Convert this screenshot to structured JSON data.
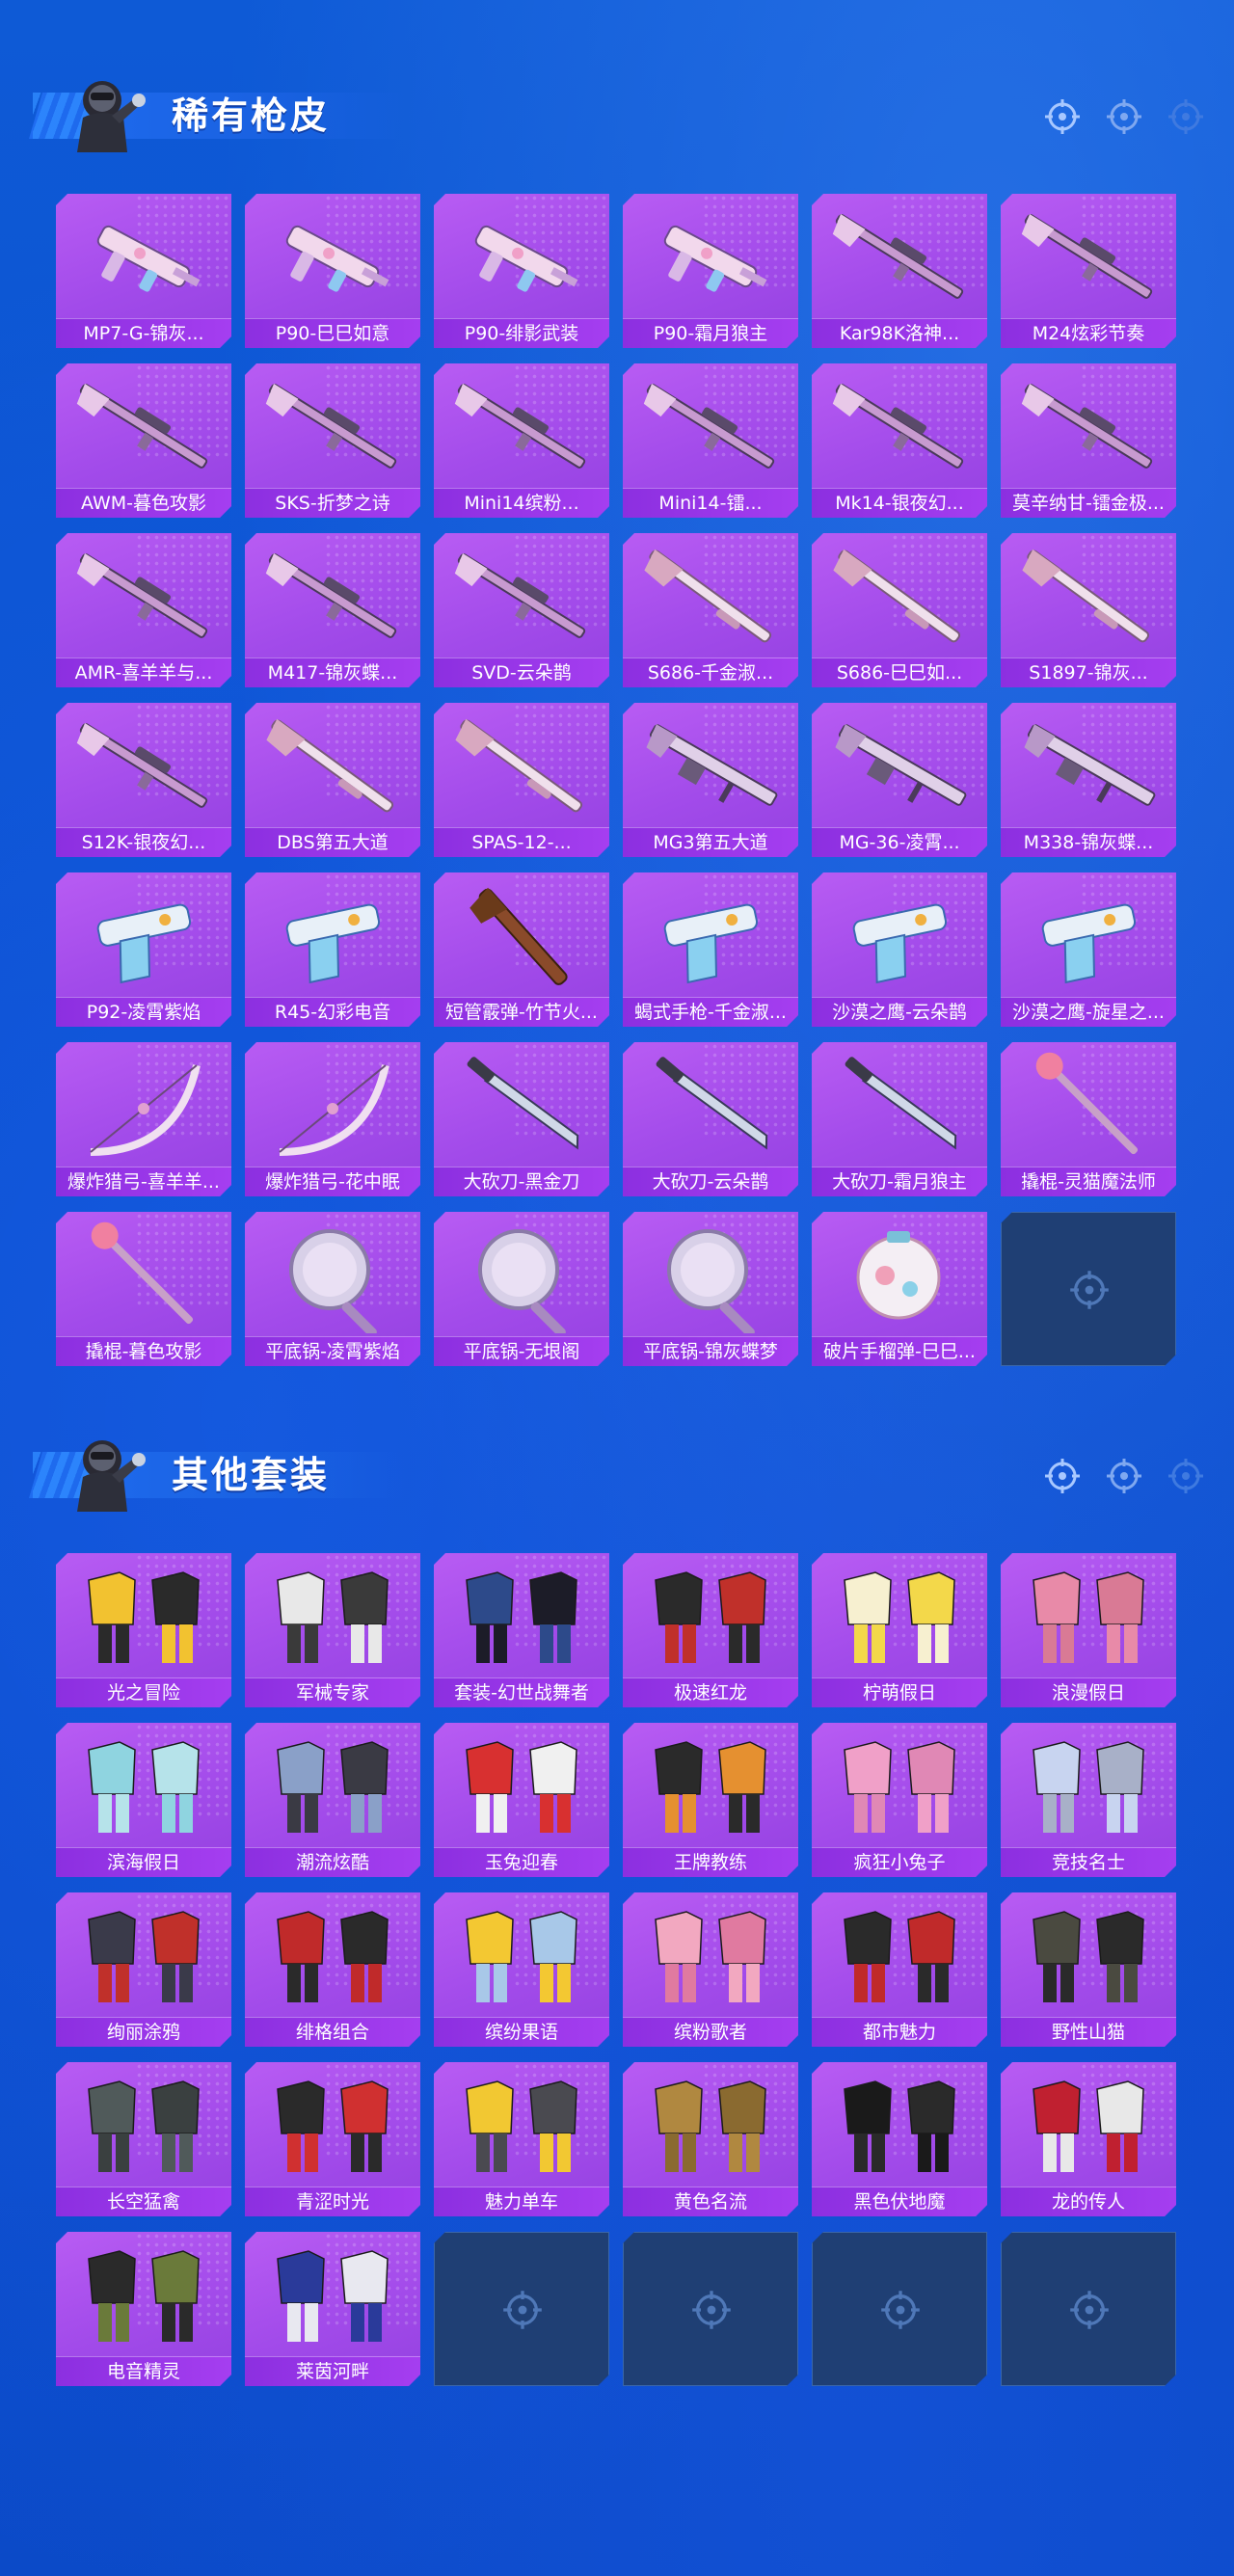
{
  "colors": {
    "background": "#0b4fd0",
    "card": "#a84ff0",
    "label_bar": "#9a38e8",
    "empty_slot": "#1f3f74",
    "accent_light": "#a8c8ff"
  },
  "sections": {
    "weapons": {
      "title": "稀有枪皮",
      "icon": "soldier-avatar-icon",
      "items": [
        {
          "label": "MP7-G-锦灰...",
          "icon": "smg-icon"
        },
        {
          "label": "P90-巳巳如意",
          "icon": "smg-icon"
        },
        {
          "label": "P90-绯影武装",
          "icon": "smg-icon"
        },
        {
          "label": "P90-霜月狼主",
          "icon": "smg-icon"
        },
        {
          "label": "Kar98K洛神...",
          "icon": "rifle-icon"
        },
        {
          "label": "M24炫彩节奏",
          "icon": "rifle-icon"
        },
        {
          "label": "AWM-暮色攻影",
          "icon": "rifle-icon"
        },
        {
          "label": "SKS-折梦之诗",
          "icon": "rifle-icon"
        },
        {
          "label": "Mini14缤粉...",
          "icon": "rifle-icon"
        },
        {
          "label": "Mini14-镭...",
          "icon": "rifle-icon"
        },
        {
          "label": "Mk14-银夜幻...",
          "icon": "rifle-icon"
        },
        {
          "label": "莫辛纳甘-镭金极...",
          "icon": "rifle-icon"
        },
        {
          "label": "AMR-喜羊羊与...",
          "icon": "rifle-icon"
        },
        {
          "label": "M417-锦灰蝶...",
          "icon": "rifle-icon"
        },
        {
          "label": "SVD-云朵鹊",
          "icon": "rifle-icon"
        },
        {
          "label": "S686-千金淑...",
          "icon": "shotgun-icon"
        },
        {
          "label": "S686-巳巳如...",
          "icon": "shotgun-icon"
        },
        {
          "label": "S1897-锦灰...",
          "icon": "shotgun-icon"
        },
        {
          "label": "S12K-银夜幻...",
          "icon": "rifle-icon"
        },
        {
          "label": "DBS第五大道",
          "icon": "shotgun-icon"
        },
        {
          "label": "SPAS-12-...",
          "icon": "shotgun-icon"
        },
        {
          "label": "MG3第五大道",
          "icon": "machinegun-icon"
        },
        {
          "label": "MG-36-凌霄...",
          "icon": "machinegun-icon"
        },
        {
          "label": "M338-锦灰蝶...",
          "icon": "machinegun-icon"
        },
        {
          "label": "P92-凌霄紫焰",
          "icon": "pistol-icon"
        },
        {
          "label": "R45-幻彩电音",
          "icon": "pistol-icon"
        },
        {
          "label": "短管霰弹-竹节火...",
          "icon": "sawed-off-icon"
        },
        {
          "label": "蝎式手枪-千金淑...",
          "icon": "pistol-icon"
        },
        {
          "label": "沙漠之鹰-云朵鹊",
          "icon": "pistol-icon"
        },
        {
          "label": "沙漠之鹰-旋星之...",
          "icon": "pistol-icon"
        },
        {
          "label": "爆炸猎弓-喜羊羊...",
          "icon": "bow-icon"
        },
        {
          "label": "爆炸猎弓-花中眠",
          "icon": "bow-icon"
        },
        {
          "label": "大砍刀-黑金刀",
          "icon": "machete-icon"
        },
        {
          "label": "大砍刀-云朵鹊",
          "icon": "machete-icon"
        },
        {
          "label": "大砍刀-霜月狼主",
          "icon": "machete-icon"
        },
        {
          "label": "撬棍-灵猫魔法师",
          "icon": "crowbar-icon"
        },
        {
          "label": "撬棍-暮色攻影",
          "icon": "crowbar-icon"
        },
        {
          "label": "平底锅-凌霄紫焰",
          "icon": "pan-icon"
        },
        {
          "label": "平底锅-无垠阁",
          "icon": "pan-icon"
        },
        {
          "label": "平底锅-锦灰蝶梦",
          "icon": "pan-icon"
        },
        {
          "label": "破片手榴弹-巳巳...",
          "icon": "grenade-icon"
        }
      ],
      "empty_slots": 1
    },
    "outfits": {
      "title": "其他套装",
      "icon": "soldier-avatar-icon",
      "items": [
        {
          "label": "光之冒险",
          "icon": "outfit-icon",
          "c1": "#f2c230",
          "c2": "#2a2a2a"
        },
        {
          "label": "军械专家",
          "icon": "outfit-icon",
          "c1": "#e8e8e8",
          "c2": "#3a3a3a"
        },
        {
          "label": "套装-幻世战舞者",
          "icon": "outfit-icon",
          "c1": "#2d4a8a",
          "c2": "#1c1c28"
        },
        {
          "label": "极速红龙",
          "icon": "outfit-icon",
          "c1": "#2a2a2a",
          "c2": "#c0302a"
        },
        {
          "label": "柠萌假日",
          "icon": "outfit-icon",
          "c1": "#f7f0d0",
          "c2": "#f3d84a"
        },
        {
          "label": "浪漫假日",
          "icon": "outfit-icon",
          "c1": "#e88aa8",
          "c2": "#d97a95"
        },
        {
          "label": "滨海假日",
          "icon": "outfit-icon",
          "c1": "#8fd4e0",
          "c2": "#b6e3ea"
        },
        {
          "label": "潮流炫酷",
          "icon": "outfit-icon",
          "c1": "#8aa0c8",
          "c2": "#3a3a44"
        },
        {
          "label": "玉兔迎春",
          "icon": "outfit-icon",
          "c1": "#d83030",
          "c2": "#f0f0f0"
        },
        {
          "label": "王牌教练",
          "icon": "outfit-icon",
          "c1": "#2a2a2a",
          "c2": "#e59030"
        },
        {
          "label": "疯狂小兔子",
          "icon": "outfit-icon",
          "c1": "#f0a0c8",
          "c2": "#e088b5"
        },
        {
          "label": "竞技名士",
          "icon": "outfit-icon",
          "c1": "#c8d4f0",
          "c2": "#a8b0c8"
        },
        {
          "label": "绚丽涂鸦",
          "icon": "outfit-icon",
          "c1": "#3a3a4a",
          "c2": "#c0302a"
        },
        {
          "label": "绯格组合",
          "icon": "outfit-icon",
          "c1": "#c02a2a",
          "c2": "#2a2a2a"
        },
        {
          "label": "缤纷果语",
          "icon": "outfit-icon",
          "c1": "#f3c832",
          "c2": "#a8c8e8"
        },
        {
          "label": "缤粉歌者",
          "icon": "outfit-icon",
          "c1": "#f2a8c0",
          "c2": "#e07aa0"
        },
        {
          "label": "都市魅力",
          "icon": "outfit-icon",
          "c1": "#2a2a2a",
          "c2": "#c02a2a"
        },
        {
          "label": "野性山猫",
          "icon": "outfit-icon",
          "c1": "#4a4a40",
          "c2": "#2a2a2a"
        },
        {
          "label": "长空猛禽",
          "icon": "outfit-icon",
          "c1": "#505a5a",
          "c2": "#3a4040"
        },
        {
          "label": "青涩时光",
          "icon": "outfit-icon",
          "c1": "#2a2a2a",
          "c2": "#d03030"
        },
        {
          "label": "魅力单车",
          "icon": "outfit-icon",
          "c1": "#f2c832",
          "c2": "#4a4a50"
        },
        {
          "label": "黄色名流",
          "icon": "outfit-icon",
          "c1": "#b08840",
          "c2": "#8a6a30"
        },
        {
          "label": "黑色伏地魔",
          "icon": "outfit-icon",
          "c1": "#1a1a1a",
          "c2": "#2a2a2a"
        },
        {
          "label": "龙的传人",
          "icon": "outfit-icon",
          "c1": "#c02030",
          "c2": "#e8e8e8"
        },
        {
          "label": "电音精灵",
          "icon": "outfit-icon",
          "c1": "#2a2a2a",
          "c2": "#6a7a3a"
        },
        {
          "label": "莱茵河畔",
          "icon": "outfit-icon",
          "c1": "#2a3a9a",
          "c2": "#e8e8f0"
        }
      ],
      "empty_slots": 4
    }
  },
  "header_icons": [
    "crosshair-icon",
    "crosshair-icon",
    "crosshair-icon"
  ]
}
